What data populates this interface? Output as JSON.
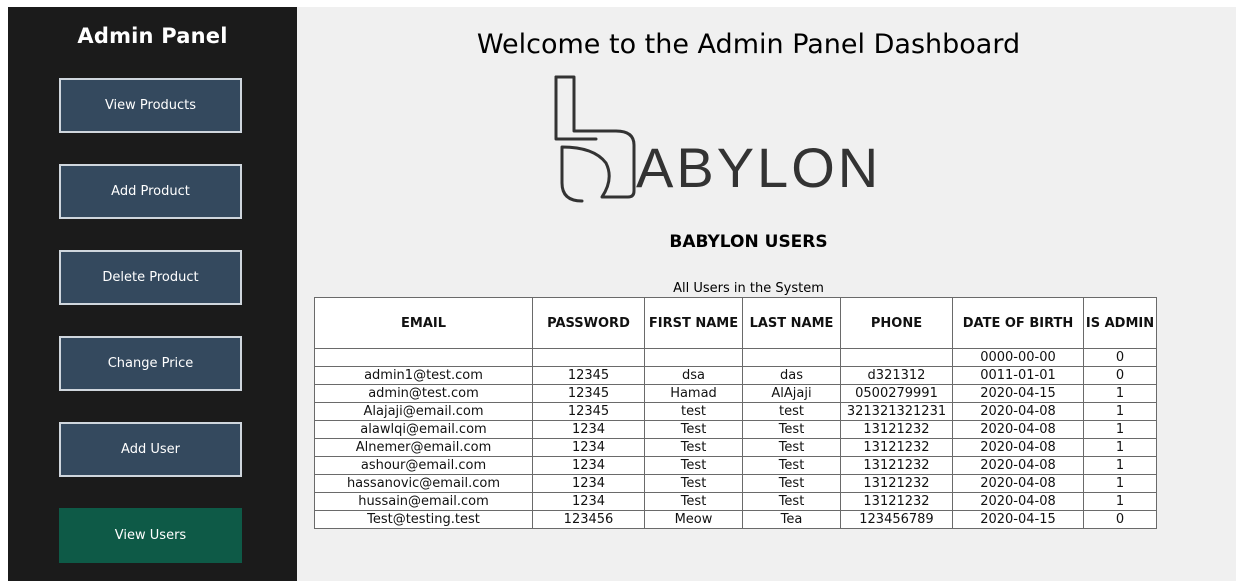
{
  "sidebar": {
    "title": "Admin Panel",
    "buttons": [
      {
        "label": "View Products"
      },
      {
        "label": "Add Product"
      },
      {
        "label": "Delete Product"
      },
      {
        "label": "Change Price"
      },
      {
        "label": "Add User"
      },
      {
        "label": "View Users",
        "active": true
      }
    ]
  },
  "main": {
    "title": "Welcome to the Admin Panel Dashboard",
    "logo_text": "ABYLON",
    "section_title": "BABYLON USERS",
    "table_caption": "All Users in the System",
    "table": {
      "headers": [
        "EMAIL",
        "PASSWORD",
        "FIRST NAME",
        "LAST NAME",
        "PHONE",
        "DATE OF BIRTH",
        "IS ADMIN"
      ],
      "rows": [
        [
          "",
          "",
          "",
          "",
          "",
          "0000-00-00",
          "0"
        ],
        [
          "admin1@test.com",
          "12345",
          "dsa",
          "das",
          "d321312",
          "0011-01-01",
          "0"
        ],
        [
          "admin@test.com",
          "12345",
          "Hamad",
          "AlAjaji",
          "0500279991",
          "2020-04-15",
          "1"
        ],
        [
          "Alajaji@email.com",
          "12345",
          "test",
          "test",
          "321321321231",
          "2020-04-08",
          "1"
        ],
        [
          "alawlqi@email.com",
          "1234",
          "Test",
          "Test",
          "13121232",
          "2020-04-08",
          "1"
        ],
        [
          "Alnemer@email.com",
          "1234",
          "Test",
          "Test",
          "13121232",
          "2020-04-08",
          "1"
        ],
        [
          "ashour@email.com",
          "1234",
          "Test",
          "Test",
          "13121232",
          "2020-04-08",
          "1"
        ],
        [
          "hassanovic@email.com",
          "1234",
          "Test",
          "Test",
          "13121232",
          "2020-04-08",
          "1"
        ],
        [
          "hussain@email.com",
          "1234",
          "Test",
          "Test",
          "13121232",
          "2020-04-08",
          "1"
        ],
        [
          "Test@testing.test",
          "123456",
          "Meow",
          "Tea",
          "123456789",
          "2020-04-15",
          "0"
        ]
      ]
    }
  },
  "colors": {
    "sidebar_bg": "#1b1b1b",
    "button_bg": "#34495e",
    "active_button_bg": "#0e5a47",
    "main_bg": "#f0f0f0"
  }
}
